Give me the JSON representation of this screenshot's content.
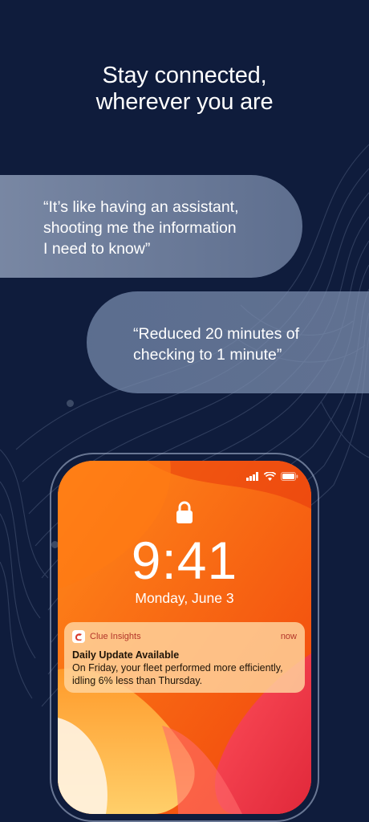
{
  "headline": {
    "line1": "Stay connected,",
    "line2": "wherever you are"
  },
  "testimonials": [
    {
      "lines": [
        "“It’s like having an assistant,",
        "shooting me the information",
        "I need to know”"
      ]
    },
    {
      "lines": [
        "“Reduced 20 minutes of",
        "checking to 1 minute”"
      ]
    }
  ],
  "lock_screen": {
    "time": "9:41",
    "date": "Monday, June 3"
  },
  "notification": {
    "app_name": "Clue Insights",
    "time": "now",
    "title": "Daily Update Available",
    "body_lines": [
      "On Friday, your fleet performed more efficiently,",
      "idling 6% less than Thursday."
    ]
  },
  "colors": {
    "background": "#0f1c3c",
    "wallpaper_orange": "#f25a10",
    "brand_red": "#d83a2c"
  },
  "icons": [
    "lock-icon",
    "signal-icon",
    "wifi-icon",
    "battery-icon",
    "clue-app-icon"
  ]
}
